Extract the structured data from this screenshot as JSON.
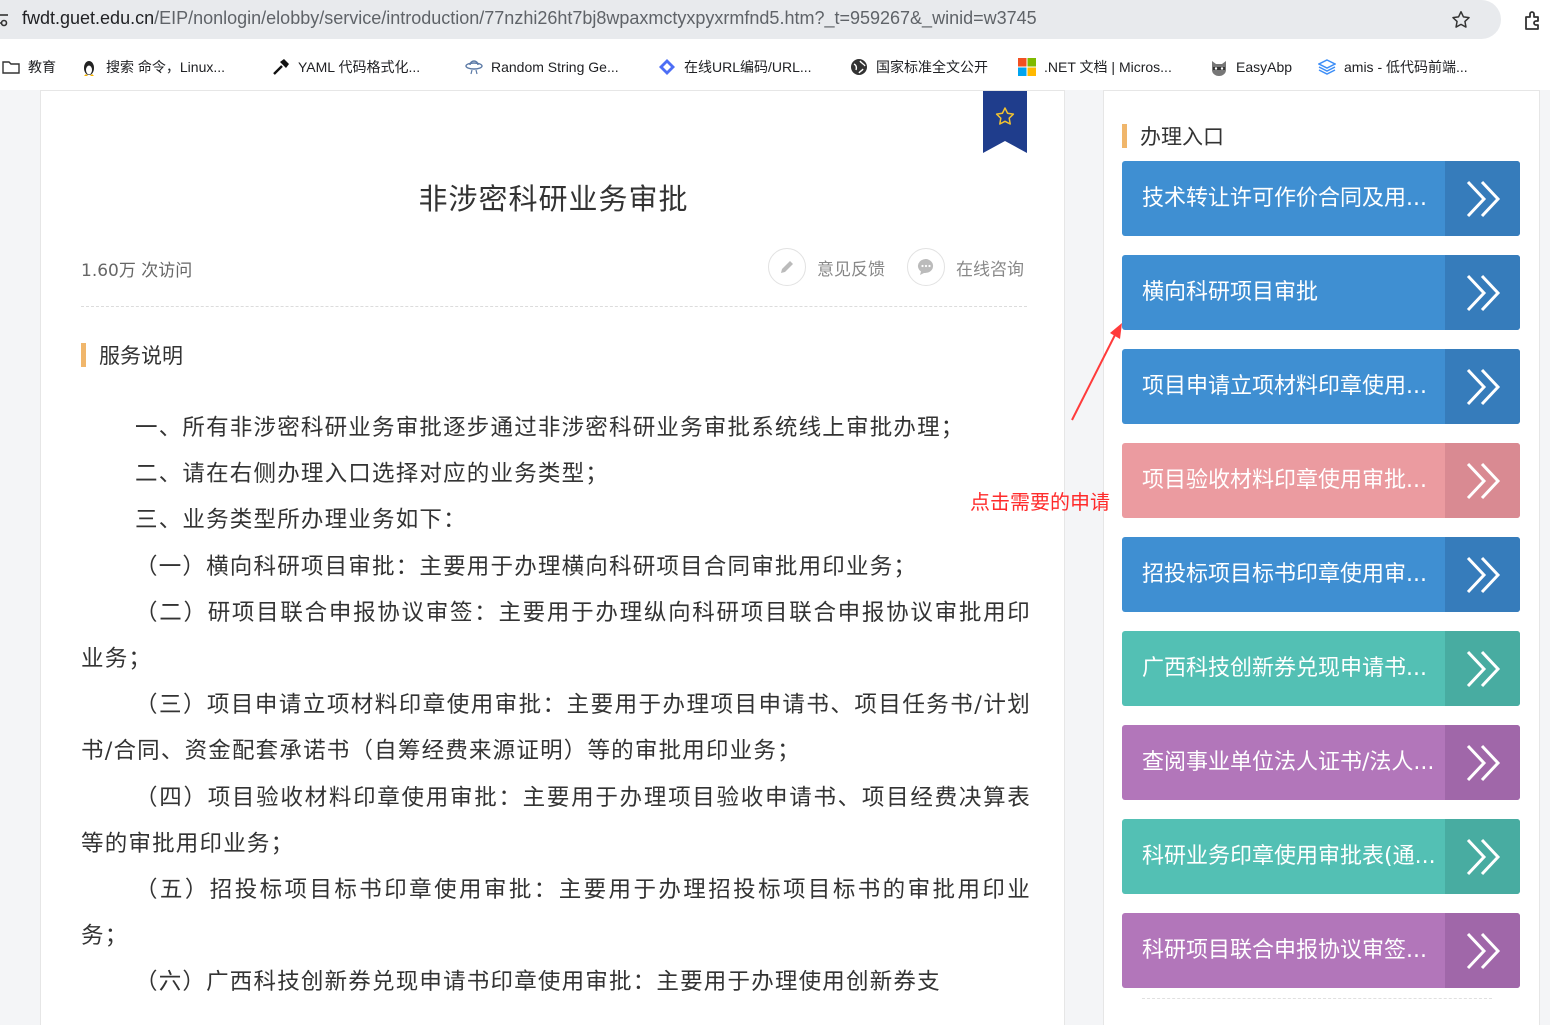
{
  "browser": {
    "url_host": "fwdt.guet.edu.cn",
    "url_path": "/EIP/nonlogin/elobby/service/introduction/77nzhi26ht7bj8wpaxmctyxpyxrmfnd5.htm?_t=959267&_winid=w3745"
  },
  "bookmarks": [
    {
      "label": "教育",
      "icon": "folder-icon"
    },
    {
      "label": "搜索 命令，Linux...",
      "icon": "penguin-icon"
    },
    {
      "label": "YAML 代码格式化...",
      "icon": "hammer-icon"
    },
    {
      "label": "Random String Ge...",
      "icon": "ufo-icon"
    },
    {
      "label": "在线URL编码/URL...",
      "icon": "diamond-icon"
    },
    {
      "label": "国家标准全文公开",
      "icon": "globe-icon"
    },
    {
      "label": ".NET 文档 | Micros...",
      "icon": "windows-icon"
    },
    {
      "label": "EasyAbp",
      "icon": "raccoon-icon"
    },
    {
      "label": "amis - 低代码前端...",
      "icon": "layers-icon"
    }
  ],
  "main": {
    "title": "非涉密科研业务审批",
    "visits": "1.60万 次访问",
    "feedback_label": "意见反馈",
    "consult_label": "在线咨询",
    "section_title": "服务说明",
    "paragraphs": [
      "一、所有非涉密科研业务审批逐步通过非涉密科研业务审批系统线上审批办理；",
      "二、请在右侧办理入口选择对应的业务类型；",
      "三、业务类型所办理业务如下：",
      "（一）横向科研项目审批：主要用于办理横向科研项目合同审批用印业务；",
      "（二）研项目联合申报协议审签：主要用于办理纵向科研项目联合申报协议审批用印业务；",
      "（三）项目申请立项材料印章使用审批：主要用于办理项目申请书、项目任务书/计划书/合同、资金配套承诺书（自筹经费来源证明）等的审批用印业务；",
      "（四）项目验收材料印章使用审批：主要用于办理项目验收申请书、项目经费决算表等的审批用印业务；",
      "（五）招投标项目标书印章使用审批：主要用于办理招投标项目标书的审批用印业务；",
      "（六）广西科技创新券兑现申请书印章使用审批：主要用于办理使用创新券支"
    ]
  },
  "side": {
    "title": "办理入口",
    "entries": [
      {
        "label": "技术转让许可作价合同及用...",
        "color": "#3f8fd2",
        "arrow_bg": "#367cbb"
      },
      {
        "label": "横向科研项目审批",
        "color": "#3f8fd2",
        "arrow_bg": "#367cbb"
      },
      {
        "label": "项目申请立项材料印章使用...",
        "color": "#3f8fd2",
        "arrow_bg": "#367cbb"
      },
      {
        "label": "项目验收材料印章使用审批...",
        "color": "#eb9ba0",
        "arrow_bg": "#d98a92"
      },
      {
        "label": "招投标项目标书印章使用审...",
        "color": "#3f8fd2",
        "arrow_bg": "#367cbb"
      },
      {
        "label": "广西科技创新券兑现申请书...",
        "color": "#53c0b4",
        "arrow_bg": "#48aca1"
      },
      {
        "label": "查阅事业单位法人证书/法人...",
        "color": "#b276ba",
        "arrow_bg": "#a067a9"
      },
      {
        "label": "科研业务印章使用审批表(通...",
        "color": "#53c0b4",
        "arrow_bg": "#48aca1"
      },
      {
        "label": "科研项目联合申报协议审签...",
        "color": "#b276ba",
        "arrow_bg": "#a067a9"
      }
    ]
  },
  "annotation": {
    "text": "点击需要的申请",
    "color": "#ff2b2b"
  }
}
